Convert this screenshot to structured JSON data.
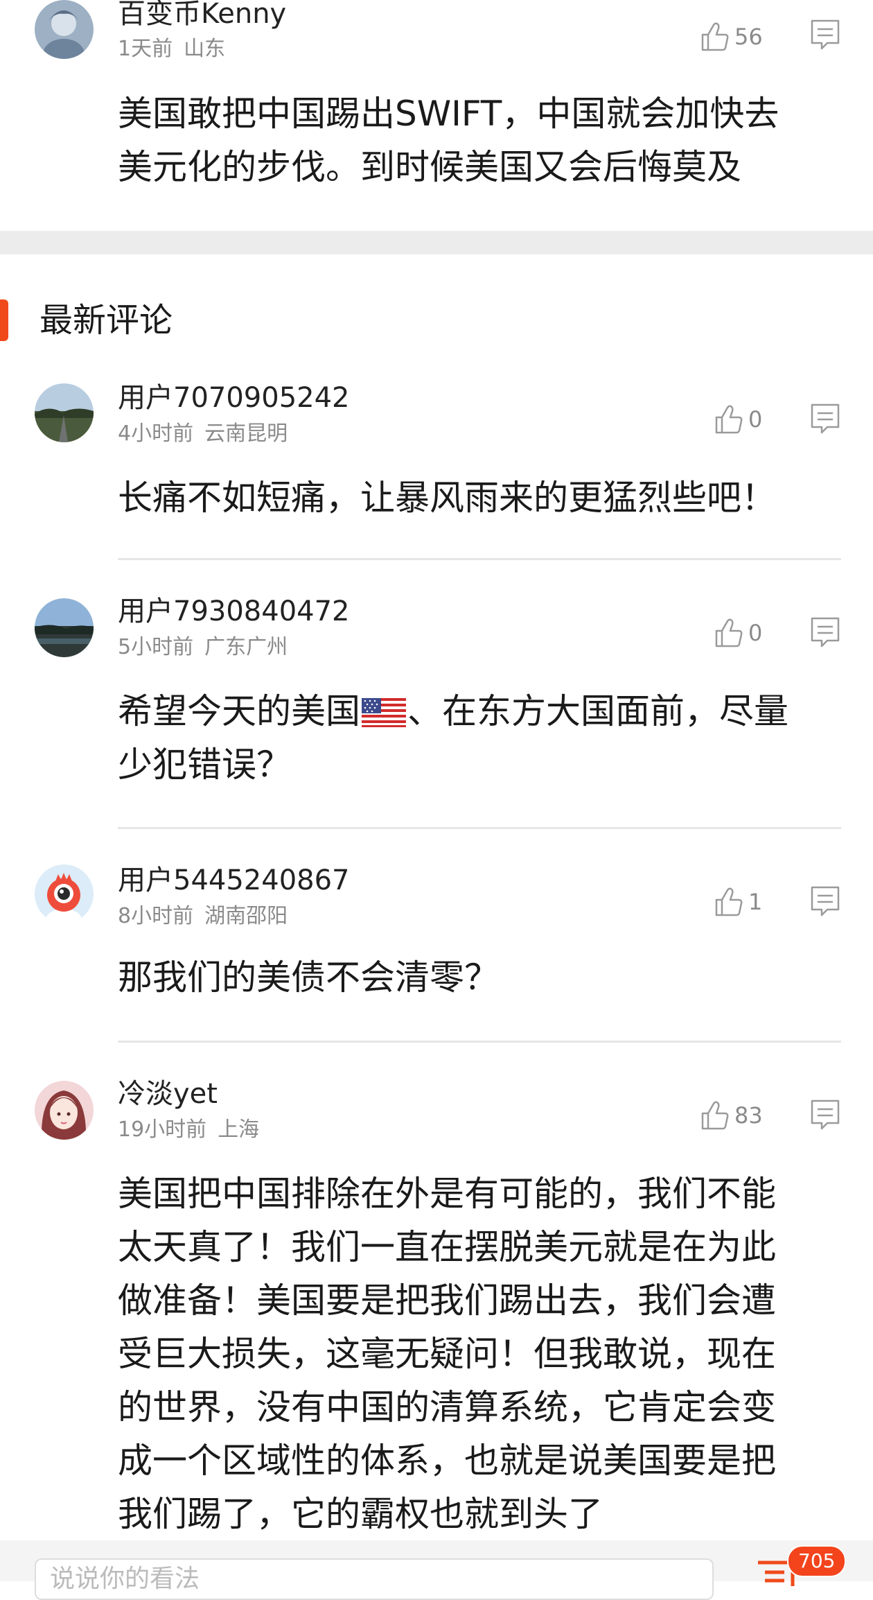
{
  "comments_top": [
    {
      "username": "百变币Kenny",
      "time": "1天前",
      "location": "山东",
      "likes": "56",
      "text_lines": [
        "美国敢把中国踢出SWIFT，中国就会加快去",
        "美元化的步伐。到时候美国又会后悔莫及"
      ]
    }
  ],
  "section": {
    "title": "最新评论"
  },
  "comments": [
    {
      "username": "用户7070905242",
      "time": "4小时前",
      "location": "云南昆明",
      "likes": "0",
      "text_lines": [
        "长痛不如短痛，让暴风雨来的更猛烈些吧！"
      ]
    },
    {
      "username": "用户7930840472",
      "time": "5小时前",
      "location": "广东广州",
      "likes": "0",
      "text_part1": "希望今天的美国",
      "text_part2": "、在东方大国面前，尽量",
      "text_line2": "少犯错误？"
    },
    {
      "username": "用户5445240867",
      "time": "8小时前",
      "location": "湖南邵阳",
      "likes": "1",
      "text_lines": [
        "那我们的美债不会清零？"
      ]
    },
    {
      "username": "冷淡yet",
      "time": "19小时前",
      "location": "上海",
      "likes": "83",
      "text_lines": [
        "美国把中国排除在外是有可能的，我们不能",
        "太天真了！我们一直在摆脱美元就是在为此",
        "做准备！美国要是把我们踢出去，我们会遭",
        "受巨大损失，这毫无疑问！但我敢说，现在",
        "的世界，没有中国的清算系统，它肯定会变",
        "成一个区域性的体系，也就是说美国要是把",
        "我们踢了，它的霸权也就到头了"
      ]
    }
  ],
  "bottom": {
    "input_placeholder": "说说你的看法",
    "comment_count": "705"
  },
  "colors": {
    "accent": "#f04a1a",
    "badge": "#f3441c",
    "meta_text": "#8a8a8a"
  },
  "icons": [
    "like-icon",
    "reply-icon",
    "comment-count-icon",
    "us-flag-emoji"
  ]
}
